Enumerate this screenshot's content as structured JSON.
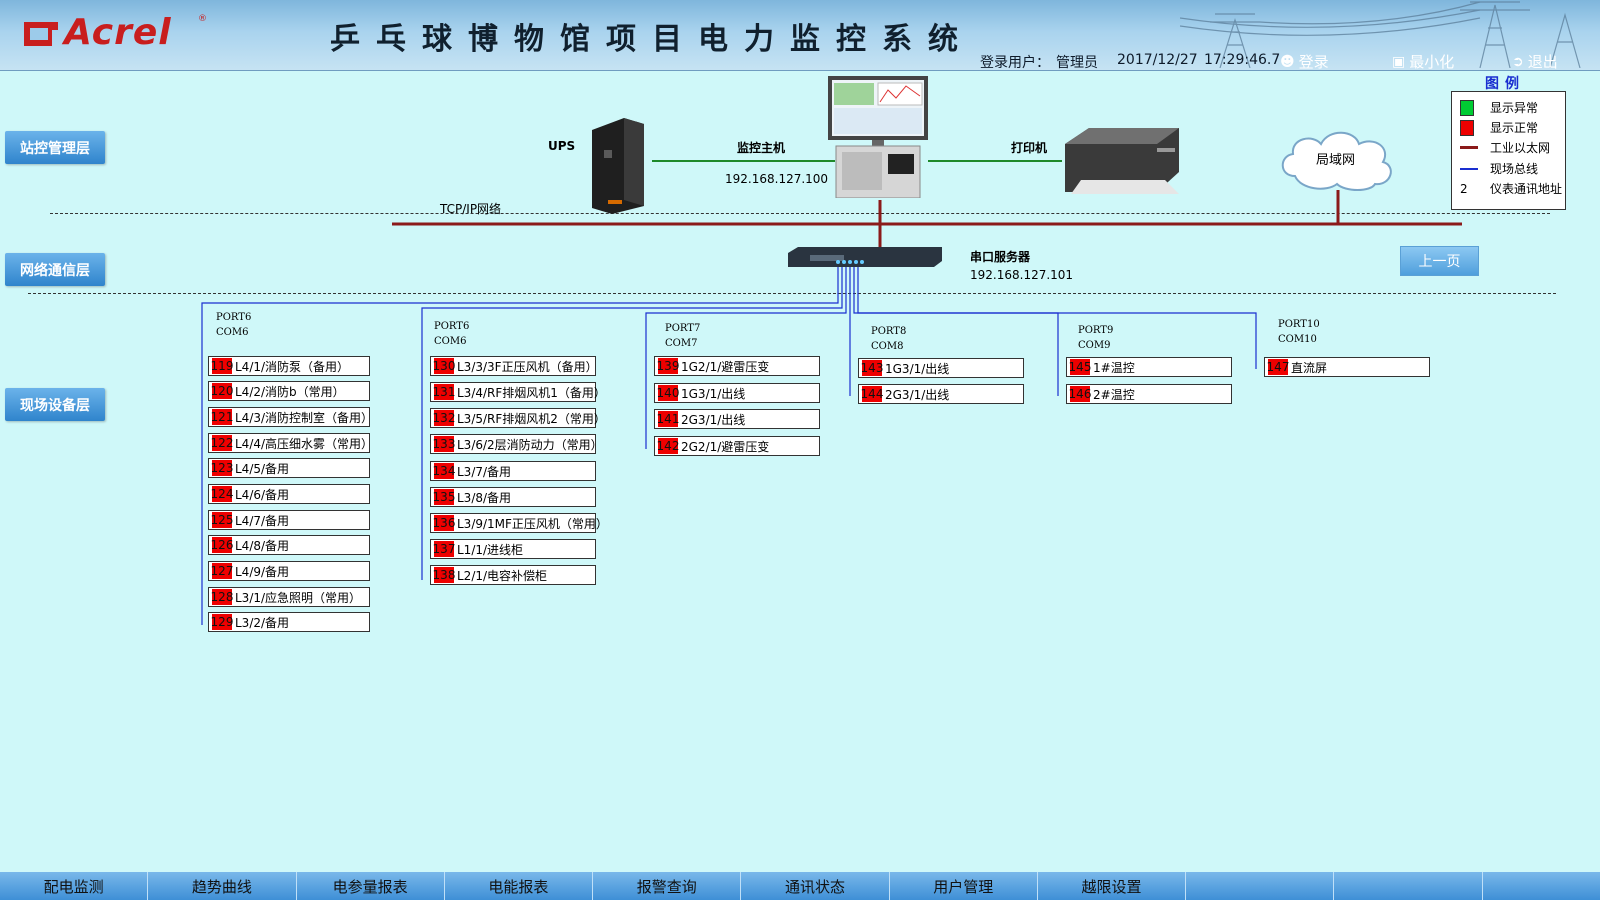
{
  "header": {
    "brand": "Acrel",
    "brand_mark": "®",
    "title": "乒乓球博物馆项目电力监控系统",
    "login_user_label": "登录用户：",
    "login_user": "管理员",
    "date": "2017/12/27",
    "time": "17:29:46.7",
    "login_label": "登录",
    "minimize_label": "最小化",
    "exit_label": "退出"
  },
  "layers": {
    "station": "站控管理层",
    "network": "网络通信层",
    "field": "现场设备层"
  },
  "devices": {
    "ups": "UPS",
    "host": "监控主机",
    "host_ip": "192.168.127.100",
    "printer": "打印机",
    "lan": "局域网",
    "tcpip": "TCP/IP网络",
    "serial_server": "串口服务器",
    "serial_ip": "192.168.127.101"
  },
  "legend": {
    "title": "图例",
    "items": [
      {
        "label": "显示异常",
        "color": "#00cc33"
      },
      {
        "label": "显示正常",
        "color": "#ee0000"
      },
      {
        "label": "工业以太网",
        "color": "#8b1a1a"
      },
      {
        "label": "现场总线",
        "color": "#1a2fd0"
      },
      {
        "label": "仪表通讯地址",
        "symbol": "2"
      }
    ]
  },
  "prev_page": "上一页",
  "ports": [
    {
      "port": "PORT6",
      "com": "COM6",
      "rows": [
        {
          "addr": "119",
          "name": "L4/1/消防泵（备用）"
        },
        {
          "addr": "120",
          "name": "L4/2/消防b（常用）"
        },
        {
          "addr": "121",
          "name": "L4/3/消防控制室（备用）"
        },
        {
          "addr": "122",
          "name": "L4/4/高压细水雾（常用）"
        },
        {
          "addr": "123",
          "name": "L4/5/备用"
        },
        {
          "addr": "124",
          "name": "L4/6/备用"
        },
        {
          "addr": "125",
          "name": "L4/7/备用"
        },
        {
          "addr": "126",
          "name": "L4/8/备用"
        },
        {
          "addr": "127",
          "name": "L4/9/备用"
        },
        {
          "addr": "128",
          "name": "L3/1/应急照明（常用）"
        },
        {
          "addr": "129",
          "name": "L3/2/备用"
        }
      ]
    },
    {
      "port": "PORT6",
      "com": "COM6",
      "rows": [
        {
          "addr": "130",
          "name": "L3/3/3F正压风机（备用）"
        },
        {
          "addr": "131",
          "name": "L3/4/RF排烟风机1（备用）"
        },
        {
          "addr": "132",
          "name": "L3/5/RF排烟风机2（常用）"
        },
        {
          "addr": "133",
          "name": "L3/6/2层消防动力（常用）"
        },
        {
          "addr": "134",
          "name": "L3/7/备用"
        },
        {
          "addr": "135",
          "name": "L3/8/备用"
        },
        {
          "addr": "136",
          "name": "L3/9/1MF正压风机（常用）"
        },
        {
          "addr": "137",
          "name": "L1/1/进线柜"
        },
        {
          "addr": "138",
          "name": "L2/1/电容补偿柜"
        }
      ]
    },
    {
      "port": "PORT7",
      "com": "COM7",
      "rows": [
        {
          "addr": "139",
          "name": "1G2/1/避雷压变"
        },
        {
          "addr": "140",
          "name": "1G3/1/出线"
        },
        {
          "addr": "141",
          "name": "2G3/1/出线"
        },
        {
          "addr": "142",
          "name": "2G2/1/避雷压变"
        }
      ]
    },
    {
      "port": "PORT8",
      "com": "COM8",
      "rows": [
        {
          "addr": "143",
          "name": "1G3/1/出线"
        },
        {
          "addr": "144",
          "name": "2G3/1/出线"
        }
      ]
    },
    {
      "port": "PORT9",
      "com": "COM9",
      "rows": [
        {
          "addr": "145",
          "name": "1#温控"
        },
        {
          "addr": "146",
          "name": "2#温控"
        }
      ]
    },
    {
      "port": "PORT10",
      "com": "COM10",
      "rows": [
        {
          "addr": "147",
          "name": "直流屏"
        }
      ]
    }
  ],
  "nav": [
    "配电监测",
    "趋势曲线",
    "电参量报表",
    "电能报表",
    "报警查询",
    "通讯状态",
    "用户管理",
    "越限设置",
    "",
    "",
    ""
  ]
}
